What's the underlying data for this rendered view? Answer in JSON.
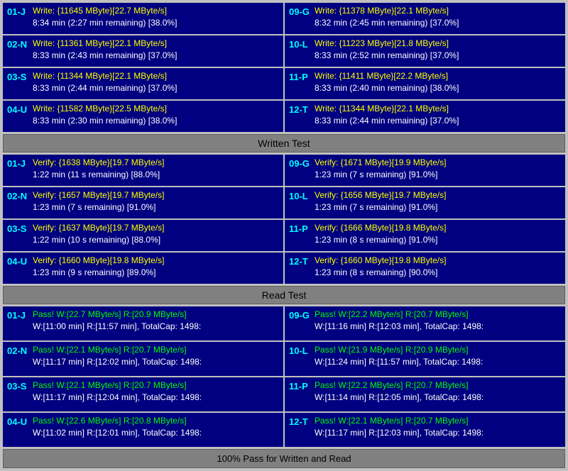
{
  "sections": {
    "written_test": {
      "header": "Written Test",
      "left_cells": [
        {
          "id": "01-J",
          "line1": "Write: {11645 MByte}[22.7 MByte/s]",
          "line2": "8:34 min (2:27 min remaining)  [38.0%]"
        },
        {
          "id": "02-N",
          "line1": "Write: {11361 MByte}[22.1 MByte/s]",
          "line2": "8:33 min (2:43 min remaining)  [37.0%]"
        },
        {
          "id": "03-S",
          "line1": "Write: {11344 MByte}[22.1 MByte/s]",
          "line2": "8:33 min (2:44 min remaining)  [37.0%]"
        },
        {
          "id": "04-U",
          "line1": "Write: {11582 MByte}[22.5 MByte/s]",
          "line2": "8:33 min (2:30 min remaining)  [38.0%]"
        }
      ],
      "right_cells": [
        {
          "id": "09-G",
          "line1": "Write: {11378 MByte}[22.1 MByte/s]",
          "line2": "8:32 min (2:45 min remaining)  [37.0%]"
        },
        {
          "id": "10-L",
          "line1": "Write: {11223 MByte}[21.8 MByte/s]",
          "line2": "8:33 min (2:52 min remaining)  [37.0%]"
        },
        {
          "id": "11-P",
          "line1": "Write: {11411 MByte}[22.2 MByte/s]",
          "line2": "8:33 min (2:40 min remaining)  [38.0%]"
        },
        {
          "id": "12-T",
          "line1": "Write: {11344 MByte}[22.1 MByte/s]",
          "line2": "8:33 min (2:44 min remaining)  [37.0%]"
        }
      ]
    },
    "verify_test": {
      "left_cells": [
        {
          "id": "01-J",
          "line1": "Verify: {1638 MByte}[19.7 MByte/s]",
          "line2": "1:22 min (11 s remaining)   [88.0%]"
        },
        {
          "id": "02-N",
          "line1": "Verify: {1657 MByte}[19.7 MByte/s]",
          "line2": "1:23 min (7 s remaining)   [91.0%]"
        },
        {
          "id": "03-S",
          "line1": "Verify: {1637 MByte}[19.7 MByte/s]",
          "line2": "1:22 min (10 s remaining)   [88.0%]"
        },
        {
          "id": "04-U",
          "line1": "Verify: {1660 MByte}[19.8 MByte/s]",
          "line2": "1:23 min (9 s remaining)   [89.0%]"
        }
      ],
      "right_cells": [
        {
          "id": "09-G",
          "line1": "Verify: {1671 MByte}[19.9 MByte/s]",
          "line2": "1:23 min (7 s remaining)   [91.0%]"
        },
        {
          "id": "10-L",
          "line1": "Verify: {1656 MByte}[19.7 MByte/s]",
          "line2": "1:23 min (7 s remaining)   [91.0%]"
        },
        {
          "id": "11-P",
          "line1": "Verify: {1666 MByte}[19.8 MByte/s]",
          "line2": "1:23 min (8 s remaining)   [91.0%]"
        },
        {
          "id": "12-T",
          "line1": "Verify: {1660 MByte}[19.8 MByte/s]",
          "line2": "1:23 min (8 s remaining)   [90.0%]"
        }
      ]
    },
    "read_test": {
      "header": "Read Test",
      "left_cells": [
        {
          "id": "01-J",
          "line1": "Pass! W:[22.7 MByte/s] R:[20.9 MByte/s]",
          "line2": "W:[11:00 min] R:[11:57 min], TotalCap: 1498:"
        },
        {
          "id": "02-N",
          "line1": "Pass! W:[22.1 MByte/s] R:[20.7 MByte/s]",
          "line2": "W:[11:17 min] R:[12:02 min], TotalCap: 1498:"
        },
        {
          "id": "03-S",
          "line1": "Pass! W:[22.1 MByte/s] R:[20.7 MByte/s]",
          "line2": "W:[11:17 min] R:[12:04 min], TotalCap: 1498:"
        },
        {
          "id": "04-U",
          "line1": "Pass! W:[22.6 MByte/s] R:[20.8 MByte/s]",
          "line2": "W:[11:02 min] R:[12:01 min], TotalCap: 1498:"
        }
      ],
      "right_cells": [
        {
          "id": "09-G",
          "line1": "Pass! W:[22.2 MByte/s] R:[20.7 MByte/s]",
          "line2": "W:[11:16 min] R:[12:03 min], TotalCap: 1498:"
        },
        {
          "id": "10-L",
          "line1": "Pass! W:[21.9 MByte/s] R:[20.9 MByte/s]",
          "line2": "W:[11:24 min] R:[11:57 min], TotalCap: 1498:"
        },
        {
          "id": "11-P",
          "line1": "Pass! W:[22.2 MByte/s] R:[20.7 MByte/s]",
          "line2": "W:[11:14 min] R:[12:05 min], TotalCap: 1498:"
        },
        {
          "id": "12-T",
          "line1": "Pass! W:[22.1 MByte/s] R:[20.7 MByte/s]",
          "line2": "W:[11:17 min] R:[12:03 min], TotalCap: 1498:"
        }
      ]
    }
  },
  "footer": "100% Pass for Written and Read"
}
